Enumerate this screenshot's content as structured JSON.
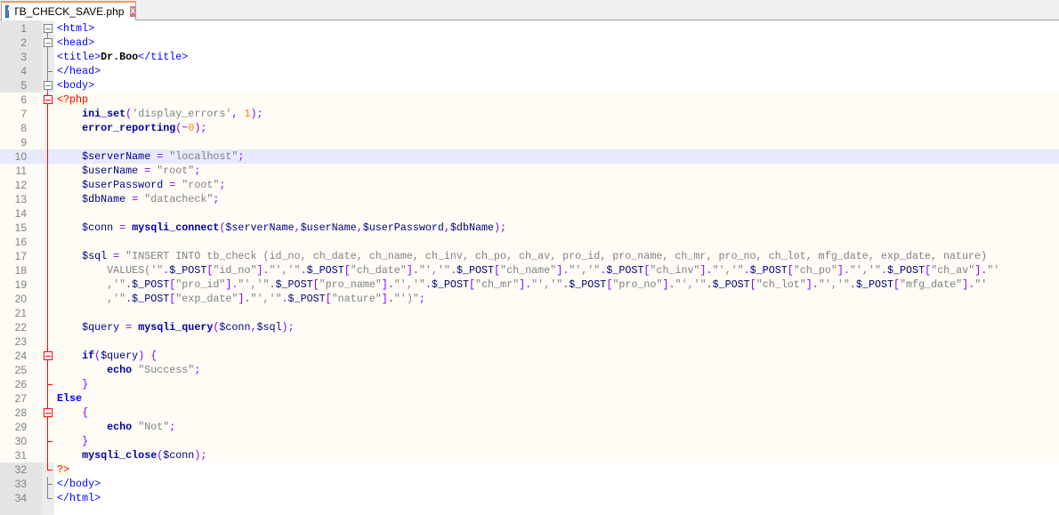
{
  "tab": {
    "filename": "TB_CHECK_SAVE.php",
    "close_label": "x"
  },
  "editor": {
    "current_line": 10,
    "lines": [
      "<html>",
      "<head>",
      "<title>Dr.Boo</title>",
      "</head>",
      "<body>",
      "<?php",
      "    ini_set('display_errors', 1);",
      "    error_reporting(~0);",
      "",
      "    $serverName = \"localhost\";",
      "    $userName = \"root\";",
      "    $userPassword = \"root\";",
      "    $dbName = \"datacheck\";",
      "",
      "    $conn = mysqli_connect($serverName,$userName,$userPassword,$dbName);",
      "",
      "    $sql = \"INSERT INTO tb_check (id_no, ch_date, ch_name, ch_inv, ch_po, ch_av, pro_id, pro_name, ch_mr, pro_no, ch_lot, mfg_date, exp_date, nature)",
      "        VALUES('\".$_POST[\"id_no\"].\"','\".$_POST[\"ch_date\"].\"','\".$_POST[\"ch_name\"].\"','\".$_POST[\"ch_inv\"].\"','\".$_POST[\"ch_po\"].\"','\".$_POST[\"ch_av\"].\"'",
      "        ,'\".$_POST[\"pro_id\"].\"','\".$_POST[\"pro_name\"].\"','\".$_POST[\"ch_mr\"].\"','\".$_POST[\"pro_no\"].\"','\".$_POST[\"ch_lot\"].\"','\".$_POST[\"mfg_date\"].\"'",
      "        ,'\".$_POST[\"exp_date\"].\"','\".$_POST[\"nature\"].\"')\";",
      "",
      "    $query = mysqli_query($conn,$sql);",
      "",
      "    if($query) {",
      "        echo \"Success\";",
      "    }",
      "Else",
      "    {",
      "        echo \"Not\";",
      "    }",
      "    mysqli_close($conn);",
      "?>",
      "</body>",
      "</html>"
    ]
  },
  "colors": {
    "accent": "#fa9b5a",
    "php_bg": "#fefcf5",
    "current_line_bg": "#e8e8ff"
  }
}
